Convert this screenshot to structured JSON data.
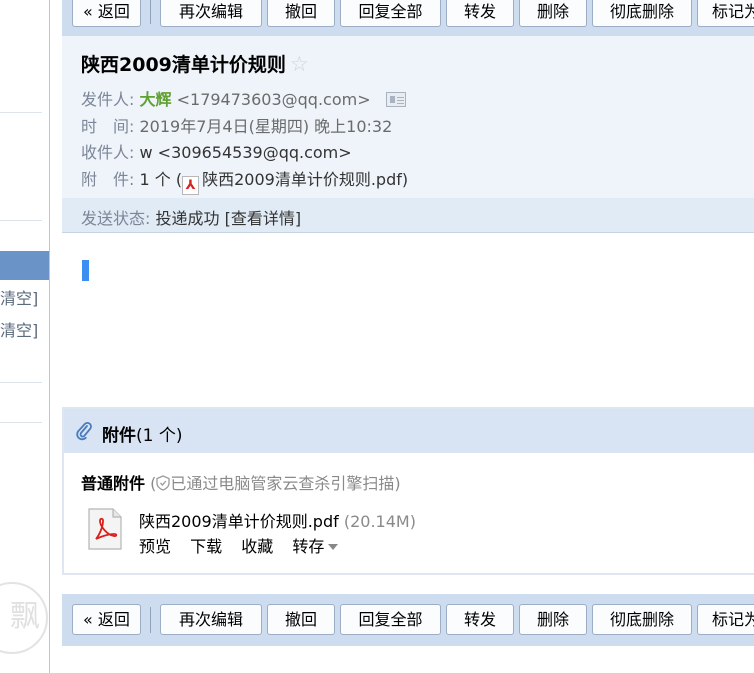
{
  "sidebar": {
    "clear_1": "清空]",
    "clear_2": "清空]",
    "seal_char": "飘"
  },
  "toolbar": {
    "back": "« 返回",
    "re_edit": "再次编辑",
    "recall": "撤回",
    "reply_all": "回复全部",
    "forward": "转发",
    "delete": "删除",
    "delete_permanent": "彻底删除",
    "mark_as": "标记为"
  },
  "header": {
    "subject": "陕西2009清单计价规则",
    "star": "☆",
    "sender_label": "发件人:",
    "sender_name": "大辉",
    "sender_email": "<179473603@qq.com>",
    "time_label": "时　间:",
    "time_value": "2019年7月4日(星期四) 晚上10:32",
    "recipient_label": "收件人:",
    "recipient_value": "w <309654539@qq.com>",
    "attachment_label": "附　件:",
    "attachment_count": "1 个 (",
    "attachment_file": "陕西2009清单计价规则.pdf",
    "attachment_close": ")"
  },
  "status": {
    "label": "发送状态:",
    "value": "投递成功",
    "detail": "[查看详情]"
  },
  "attachments": {
    "title": "附件",
    "count": "(1 个)",
    "section_label": "普通附件",
    "scan_open": "(",
    "scan_note": "已通过电脑管家云查杀引擎扫描)",
    "file_name": "陕西2009清单计价规则.pdf",
    "file_size": "(20.14M)",
    "actions": {
      "preview": "预览",
      "download": "下载",
      "favorite": "收藏",
      "save_to": "转存"
    }
  },
  "colors": {
    "toolbar_bg": "#cddcee",
    "header_bg": "#eff4fa",
    "sender_name": "#5fa132",
    "accent_blue": "#3c8ef0",
    "pdf_red": "#d9211e"
  }
}
